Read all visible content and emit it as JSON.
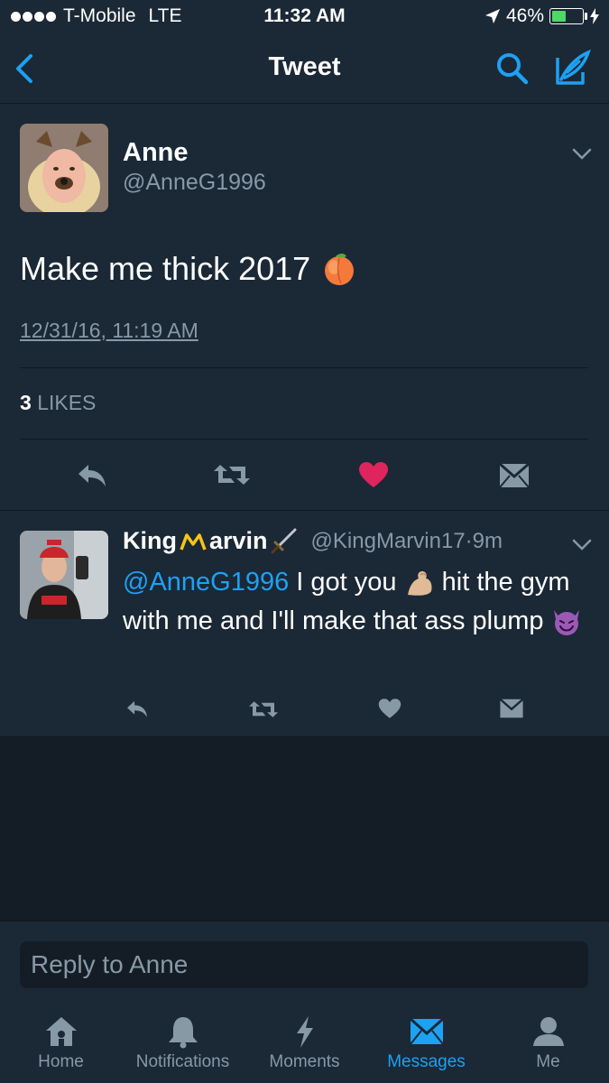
{
  "status_bar": {
    "carrier": "T-Mobile",
    "network": "LTE",
    "time": "11:32 AM",
    "battery": "46%",
    "battery_level": 0.46
  },
  "nav": {
    "title": "Tweet"
  },
  "tweet": {
    "name": "Anne",
    "handle": "@AnneG1996",
    "text": "Make me thick 2017",
    "timestamp": "12/31/16, 11:19 AM",
    "likes_count": "3",
    "likes_label": "LIKES"
  },
  "reply": {
    "name_part1": "King",
    "name_part2": "arvin",
    "handle": "@KingMarvin17",
    "separator": " · ",
    "time": "9m",
    "mention": "@AnneG1996",
    "text_a": " I got you",
    "text_b": " hit the gym with me and I'll make that ass plump"
  },
  "reply_bar": {
    "placeholder": "Reply to Anne"
  },
  "tabs": [
    {
      "label": "Home",
      "icon": "home-icon"
    },
    {
      "label": "Notifications",
      "icon": "bell-icon"
    },
    {
      "label": "Moments",
      "icon": "lightning-icon"
    },
    {
      "label": "Messages",
      "icon": "envelope-icon",
      "active": true
    },
    {
      "label": "Me",
      "icon": "person-icon"
    }
  ],
  "colors": {
    "background": "#141d26",
    "surface": "#1b2836",
    "accent": "#1da1f2",
    "muted": "#8899a6",
    "like": "#e0245e"
  }
}
